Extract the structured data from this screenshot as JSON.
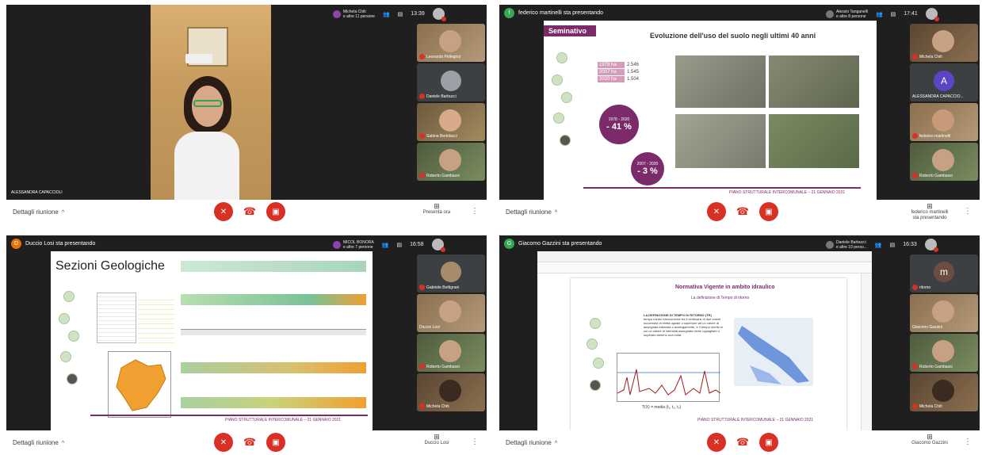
{
  "common": {
    "details_label": "Dettagli riunione",
    "more_glyph": "⋮"
  },
  "panel1": {
    "participants_count_owner": "Michela Chiti",
    "participants_count_text": "e altre 11 persone",
    "time": "13:39",
    "self_name": "ALESSANDRA CAPACCIOLI",
    "present_label": "Presenta ora",
    "tiles": [
      "Leonardo Pellegrini",
      "Daniele Barbucci",
      "Sabina Bertolacci",
      "Roberto Gambassi"
    ]
  },
  "panel2": {
    "presenter": "federico martinelli sta presentando",
    "presenter_initial": "f",
    "owner": "Alessio Tanganelli",
    "owner_more": "e altre 8 persone",
    "time": "17:41",
    "present_label": "federico martinelli sta presentando",
    "tiles": [
      "Michela Chiti",
      "ALESSANDRA CAPACCIO...",
      "federico martinelli",
      "Roberto Gambassi"
    ],
    "tile_avatar_letter": "A",
    "slide": {
      "badge": "Seminativo",
      "title": "Evoluzione dell'uso del suolo negli ultimi 40 anni",
      "stats": [
        {
          "year": "1978 ha",
          "value": "2.546"
        },
        {
          "year": "2007 ha",
          "value": "1.545"
        },
        {
          "year": "2020 ha",
          "value": "1.504"
        }
      ],
      "circle1_label": "1978 - 2020",
      "circle1_value": "- 41 %",
      "circle2_label": "2007 - 2020",
      "circle2_value": "- 3 %",
      "footer": "PIANO STRUTTURALE INTERCOMUNALE – 21 GENNAIO 2021"
    }
  },
  "panel3": {
    "presenter": "Duccio Losi sta presentando",
    "presenter_initial": "D",
    "owner": "MICOL BONORA",
    "owner_more": "e altre 7 persone",
    "time": "16:58",
    "present_label": "Duccio Losi",
    "tiles": [
      "Gabriele Bettigrani",
      "Duccio Losi",
      "Roberto Gambassi",
      "Michela Chiti"
    ],
    "slide": {
      "title": "Sezioni Geologiche",
      "footer": "PIANO STRUTTURALE INTERCOMUNALE – 21 GENNAIO 2021"
    }
  },
  "panel4": {
    "presenter": "Giacomo Gazzini sta presentando",
    "presenter_initial": "G",
    "owner": "Daniele Barbucci",
    "owner_more": "e altre 10 perso...",
    "time": "16:33",
    "present_label": "Giacomo Gazzini",
    "tile_avatar_letter": "m",
    "tiles": [
      "ritorno",
      "Giacomo Gazzini",
      "Roberto Gambassi",
      "Michela Chiti"
    ],
    "slide": {
      "title": "Normativa Vigente in ambito idraulico",
      "subtitle": "La definizione di Tempo di ritorno",
      "def_head": "LA DEFINIZIONE DI TEMPO DI RITORNO (TR)",
      "def_body": "tempo medio intercorrente tra il verificarsi di due eventi successivi di entità uguale o superiore ad un valore di assegnata intensità o analogamente, è il tempo medio in cui un valore di intensità assegnata viene uguagliato o superato almeno una volta.",
      "formula": "T(X) = media (t₁, t₂, t₃)",
      "footer": "PIANO STRUTTURALE INTERCOMUNALE – 21 GENNAIO 2021"
    }
  }
}
